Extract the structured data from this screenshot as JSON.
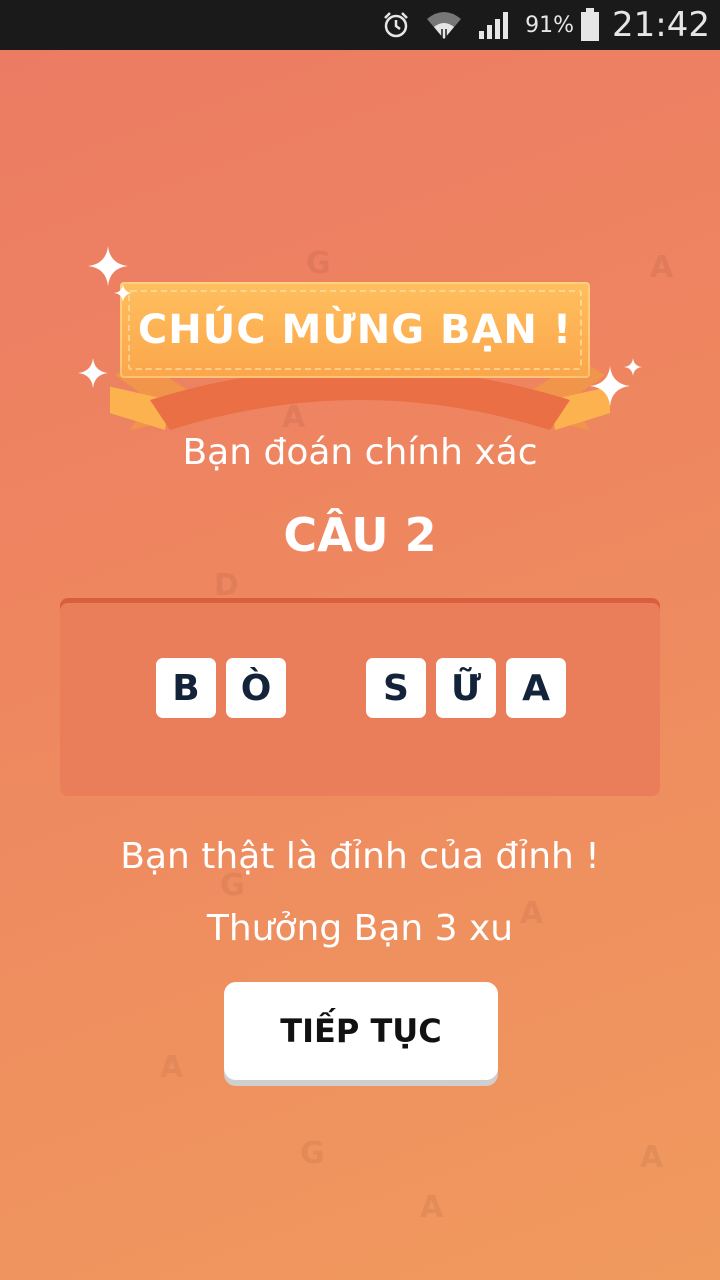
{
  "status_bar": {
    "icons": [
      "alarm-icon",
      "wifi-icon",
      "signal-icon",
      "battery-icon"
    ],
    "battery": "91%",
    "time": "21:42"
  },
  "banner": {
    "title": "CHÚC MỪNG BẠN !"
  },
  "result": {
    "subtitle": "Bạn đoán chính xác",
    "question": "CÂU 2"
  },
  "answer": {
    "words": [
      [
        "B",
        "Ò"
      ],
      [
        "S",
        "Ữ",
        "A"
      ]
    ]
  },
  "praise": "Bạn thật là đỉnh của đỉnh !",
  "reward": "Thưởng Bạn 3 xu",
  "continue_button": "TIẾP TỤC",
  "colors": {
    "background": "#ee8760",
    "ribbon": "#fbb04f",
    "panel": "#ea7e5b",
    "tile_text": "#13233a"
  }
}
